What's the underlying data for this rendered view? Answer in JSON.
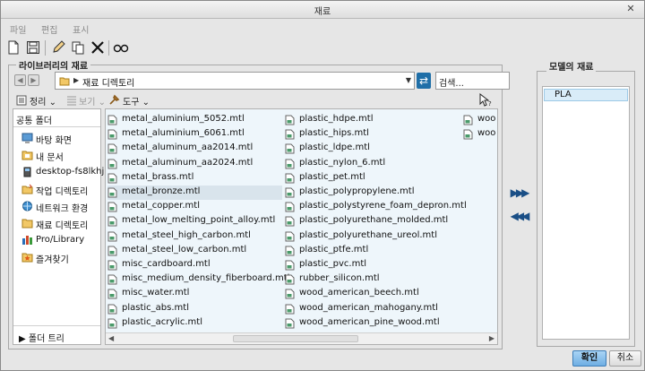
{
  "window": {
    "title": "재료"
  },
  "menu": {
    "file": "파일",
    "edit": "편집",
    "view": "표시"
  },
  "library": {
    "group_label": "라이브러리의 재료",
    "path": "재료 디렉토리",
    "search_placeholder": "검색...",
    "organize_label": "정리",
    "view_label": "보기",
    "tools_label": "도구"
  },
  "favorites": {
    "header": "공통 폴더",
    "items": [
      {
        "label": "바탕 화면",
        "icon": "desktop-icon"
      },
      {
        "label": "내 문서",
        "icon": "documents-folder-icon"
      },
      {
        "label": "desktop-fs8lkhj",
        "icon": "computer-icon"
      },
      {
        "label": "작업 디렉토리",
        "icon": "working-folder-icon"
      },
      {
        "label": "네트워크 환경",
        "icon": "network-icon"
      },
      {
        "label": "재료 디렉토리",
        "icon": "folder-icon"
      },
      {
        "label": "Pro/Library",
        "icon": "library-icon"
      },
      {
        "label": "즐겨찾기",
        "icon": "favorites-icon"
      }
    ],
    "footer": "폴더 트리"
  },
  "files": {
    "col1": [
      "metal_aluminium_5052.mtl",
      "metal_aluminium_6061.mtl",
      "metal_aluminum_aa2014.mtl",
      "metal_aluminum_aa2024.mtl",
      "metal_brass.mtl",
      "metal_bronze.mtl",
      "metal_copper.mtl",
      "metal_low_melting_point_alloy.mtl",
      "metal_steel_high_carbon.mtl",
      "metal_steel_low_carbon.mtl",
      "misc_cardboard.mtl",
      "misc_medium_density_fiberboard.mtl",
      "misc_water.mtl",
      "plastic_abs.mtl",
      "plastic_acrylic.mtl"
    ],
    "col2": [
      "plastic_hdpe.mtl",
      "plastic_hips.mtl",
      "plastic_ldpe.mtl",
      "plastic_nylon_6.mtl",
      "plastic_pet.mtl",
      "plastic_polypropylene.mtl",
      "plastic_polystyrene_foam_depron.mtl",
      "plastic_polyurethane_molded.mtl",
      "plastic_polyurethane_ureol.mtl",
      "plastic_ptfe.mtl",
      "plastic_pvc.mtl",
      "rubber_silicon.mtl",
      "wood_american_beech.mtl",
      "wood_american_mahogany.mtl",
      "wood_american_pine_wood.mtl"
    ],
    "col3": [
      "woo",
      "woo"
    ],
    "selected": "metal_bronze.mtl"
  },
  "model": {
    "group_label": "모델의 재료",
    "items": [
      "PLA"
    ]
  },
  "buttons": {
    "ok": "확인",
    "cancel": "취소"
  }
}
